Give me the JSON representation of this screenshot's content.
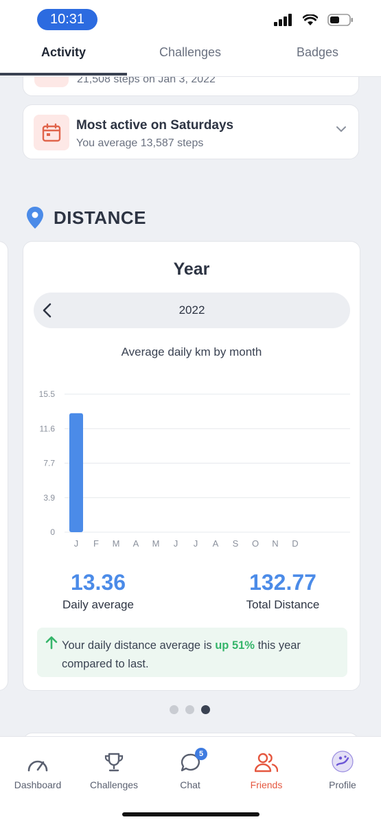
{
  "status_bar": {
    "time": "10:31"
  },
  "tabs": [
    {
      "label": "Activity",
      "active": true
    },
    {
      "label": "Challenges",
      "active": false
    },
    {
      "label": "Badges",
      "active": false
    }
  ],
  "prev_card": {
    "text": "21,508 steps on Jan 3, 2022"
  },
  "active_card": {
    "title": "Most active on Saturdays",
    "subtitle": "You average 13,587 steps",
    "icon": "calendar-icon"
  },
  "section": {
    "title": "DISTANCE",
    "icon": "location-pin-icon"
  },
  "distance_card": {
    "period_title": "Year",
    "year": "2022",
    "chart_title": "Average daily km by month",
    "daily_average_value": "13.36",
    "daily_average_label": "Daily average",
    "total_value": "132.77",
    "total_label": "Total Distance",
    "trend": {
      "prefix": "Your daily distance average is ",
      "highlight": "up 51%",
      "suffix": " this year compared to last."
    }
  },
  "chart_data": {
    "type": "bar",
    "title": "Average daily km by month",
    "categories": [
      "J",
      "F",
      "M",
      "A",
      "M",
      "J",
      "J",
      "A",
      "S",
      "O",
      "N",
      "D"
    ],
    "values": [
      13.36,
      null,
      null,
      null,
      null,
      null,
      null,
      null,
      null,
      null,
      null,
      null
    ],
    "yticks": [
      "15.5",
      "11.6",
      "7.7",
      "3.9",
      "0"
    ],
    "ylim": [
      0,
      15.5
    ],
    "grid": true,
    "bar_color": "#4b8be8"
  },
  "pager": {
    "count": 3,
    "active_index": 2
  },
  "bottom_nav": [
    {
      "label": "Dashboard",
      "icon": "gauge-icon",
      "active": false
    },
    {
      "label": "Challenges",
      "icon": "trophy-icon",
      "active": false
    },
    {
      "label": "Chat",
      "icon": "chat-bubble-icon",
      "active": false,
      "badge": "5"
    },
    {
      "label": "Friends",
      "icon": "friends-icon",
      "active": true
    },
    {
      "label": "Profile",
      "icon": "avatar-icon",
      "active": false
    }
  ],
  "colors": {
    "accent": "#4b8be8",
    "friends_active": "#e5573f",
    "positive": "#35b56a",
    "time_pill": "#2c6be0"
  }
}
